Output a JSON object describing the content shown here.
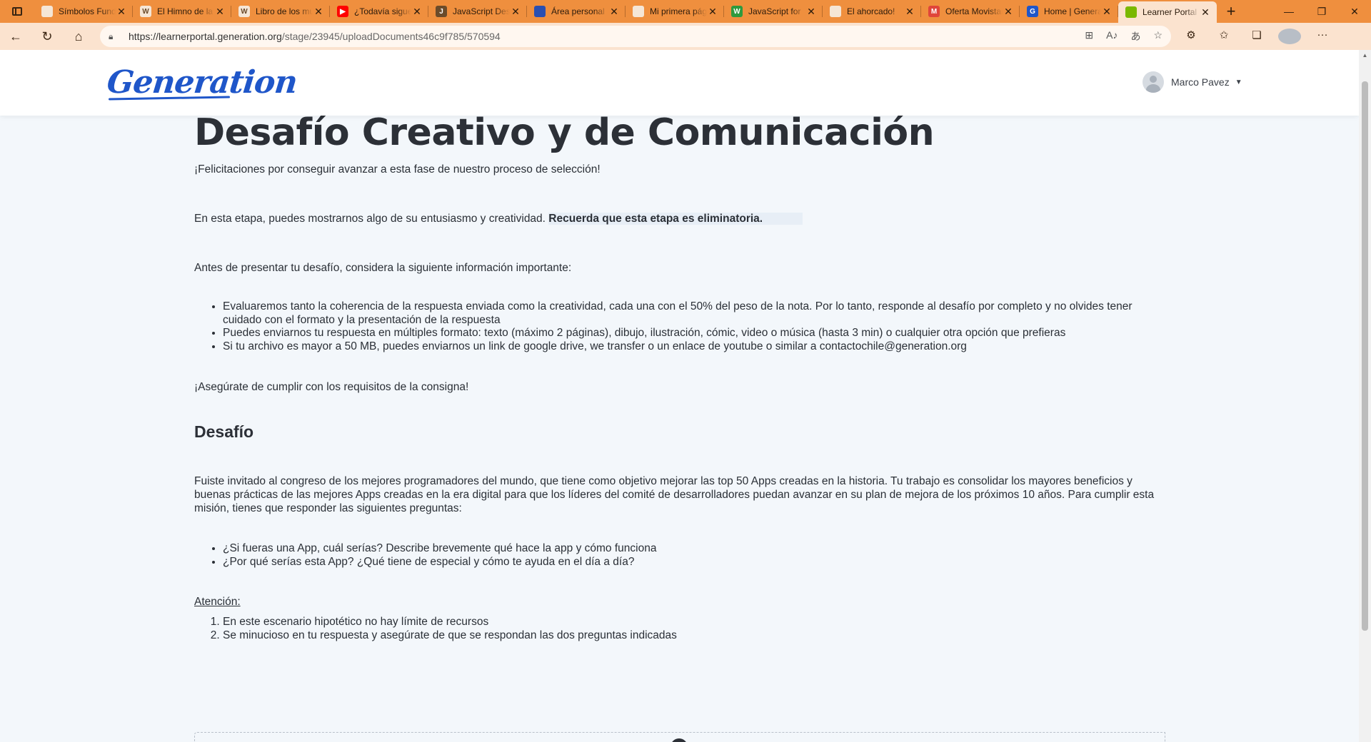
{
  "browser": {
    "tabs": [
      {
        "label": "Símbolos Fundamentales",
        "icon_color": "#f5e6d6",
        "icon_glyph": "",
        "icon": "document-icon"
      },
      {
        "label": "El Himno de la",
        "icon_color": "#f5e6d6",
        "icon_glyph": "W",
        "icon": "wikipedia-icon"
      },
      {
        "label": "Libro de los muertos",
        "icon_color": "#f5e6d6",
        "icon_glyph": "W",
        "icon": "wikipedia-icon"
      },
      {
        "label": "¿Todavía sigues",
        "icon_color": "#ff0000",
        "icon_glyph": "▶",
        "icon": "youtube-icon"
      },
      {
        "label": "JavaScript Desde",
        "icon_color": "#6b4b2a",
        "icon_glyph": "J",
        "icon": "site-icon"
      },
      {
        "label": "Área personal",
        "icon_color": "#2a4fb0",
        "icon_glyph": "",
        "icon": "flag-icon"
      },
      {
        "label": "Mi primera página",
        "icon_color": "#f5e6d6",
        "icon_glyph": "",
        "icon": "document-icon"
      },
      {
        "label": "JavaScript for",
        "icon_color": "#2e9a3e",
        "icon_glyph": "W",
        "icon": "w3-icon"
      },
      {
        "label": "El ahorcado!",
        "icon_color": "#f5e6d6",
        "icon_glyph": "",
        "icon": "document-icon"
      },
      {
        "label": "Oferta Movistar",
        "icon_color": "#e0453a",
        "icon_glyph": "M",
        "icon": "gmail-icon"
      },
      {
        "label": "Home | Generation",
        "icon_color": "#1f56c9",
        "icon_glyph": "G",
        "icon": "generation-icon"
      },
      {
        "label": "Learner Portal",
        "icon_color": "#7ab800",
        "icon_glyph": "",
        "icon": "learner-portal-icon",
        "active": true
      }
    ],
    "url_host": "https://learnerportal.generation.org",
    "url_path": "/stage/23945/uploadDocuments46c9f785/570594"
  },
  "header": {
    "logo_text": "Generation",
    "user_name": "Marco Pavez"
  },
  "main": {
    "title": "Desafío Creativo y de Comunicación",
    "congrats": "¡Felicitaciones por conseguir avanzar a esta fase de nuestro proceso de selección!",
    "stage_text": "En esta etapa, puedes mostrarnos algo de su entusiasmo y creatividad.",
    "stage_bold": "Recuerda que esta etapa es eliminatoria.",
    "before_text": "Antes de presentar tu desafío, considera la siguiente información importante:",
    "info_items": [
      "Evaluaremos tanto la coherencia de la respuesta enviada como la creatividad, cada una con el 50% del peso de la nota. Por lo tanto, responde al desafío por completo y no olvides tener cuidado con el formato y la presentación de la respuesta",
      "Puedes enviarnos tu respuesta en múltiples formato: texto (máximo 2 páginas), dibujo, ilustración, cómic, video o música (hasta 3 min) o cualquier otra opción que prefieras",
      "Si tu archivo es mayor a 50 MB, puedes enviarnos un link de google drive, we transfer o un enlace de youtube o similar a contactochile@generation.org"
    ],
    "requirements": "¡Asegúrate de cumplir con los requisitos de la consigna!",
    "challenge_heading": "Desafío",
    "challenge_text": "Fuiste invitado al congreso de los mejores programadores del mundo, que tiene como objetivo mejorar las top 50 Apps creadas en la historia. Tu trabajo es consolidar los mayores beneficios y buenas prácticas de las mejores Apps creadas en la era digital para que los líderes del comité de desarrolladores puedan avanzar en su plan de mejora de los próximos 10 años. Para cumplir esta misión, tienes que responder las siguientes preguntas:",
    "questions": [
      "¿Si fueras una App, cuál serías? Describe brevemente qué hace la app y cómo funciona",
      "¿Por qué serías esta App? ¿Qué tiene de especial y cómo te ayuda en el día a día?"
    ],
    "attention_label": "Atención:",
    "attention_items": [
      "En este escenario hipotético no hay límite de recursos",
      "Se minucioso en tu respuesta y asegúrate de que se respondan las dos preguntas indicadas"
    ]
  }
}
